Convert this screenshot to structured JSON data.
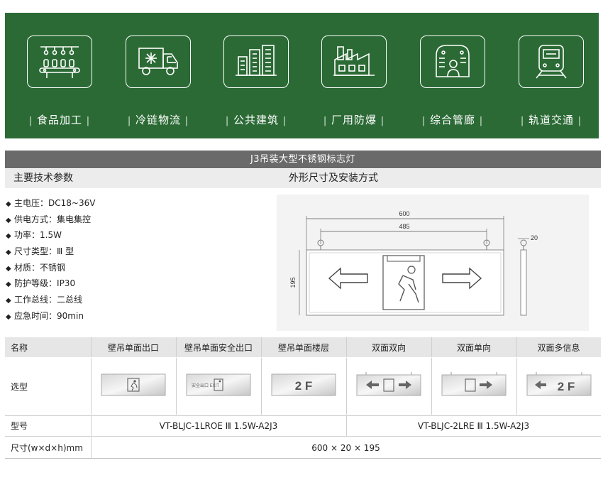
{
  "applications": [
    {
      "label": "食品加工",
      "icon": "food-processing-icon"
    },
    {
      "label": "冷链物流",
      "icon": "cold-chain-truck-icon"
    },
    {
      "label": "公共建筑",
      "icon": "public-building-icon"
    },
    {
      "label": "厂用防爆",
      "icon": "factory-icon"
    },
    {
      "label": "综合管廊",
      "icon": "utility-tunnel-icon"
    },
    {
      "label": "轨道交通",
      "icon": "train-icon"
    }
  ],
  "label_divider": "|",
  "product_title": "J3吊装大型不锈钢标志灯",
  "sections": {
    "specs_heading": "主要技术参数",
    "drawing_heading": "外形尺寸及安装方式"
  },
  "bullet": "◆",
  "specs": [
    {
      "label": "主电压",
      "value": "DC18~36V"
    },
    {
      "label": "供电方式",
      "value": "集电集控"
    },
    {
      "label": "功率",
      "value": "1.5W"
    },
    {
      "label": "尺寸类型",
      "value": "Ⅲ 型"
    },
    {
      "label": "材质",
      "value": "不锈钢"
    },
    {
      "label": "防护等级",
      "value": "IP30"
    },
    {
      "label": "工作总线",
      "value": "二总线"
    },
    {
      "label": "应急时间",
      "value": "90min"
    }
  ],
  "spec_separator": "：",
  "drawing": {
    "dim_total_width": "600",
    "dim_mount_width": "485",
    "dim_depth": "20",
    "dim_height": "195"
  },
  "table": {
    "col_name_header": "名称",
    "row_select_label": "选型",
    "row_model_label": "型号",
    "row_size_label": "尺寸(w×d×h)mm",
    "products": [
      {
        "name": "壁吊单面出口",
        "sign_text": ""
      },
      {
        "name": "壁吊单面安全出口",
        "sign_text": "安全出口 EXIT"
      },
      {
        "name": "壁吊单面楼层",
        "sign_text": "2 F"
      },
      {
        "name": "双面双向",
        "sign_text": ""
      },
      {
        "name": "双面单向",
        "sign_text": ""
      },
      {
        "name": "双面多信息",
        "sign_text": "2 F"
      }
    ],
    "model_single": "VT-BLJC-1LROE  Ⅲ  1.5W-A2J3",
    "model_double": "VT-BLJC-2LRE  Ⅲ  1.5W-A2J3",
    "size_value": "600 × 20 × 195"
  },
  "colors": {
    "banner_green": "#2b6a35",
    "title_bar": "#6a6a6a",
    "table_header": "#e6e6e6"
  }
}
